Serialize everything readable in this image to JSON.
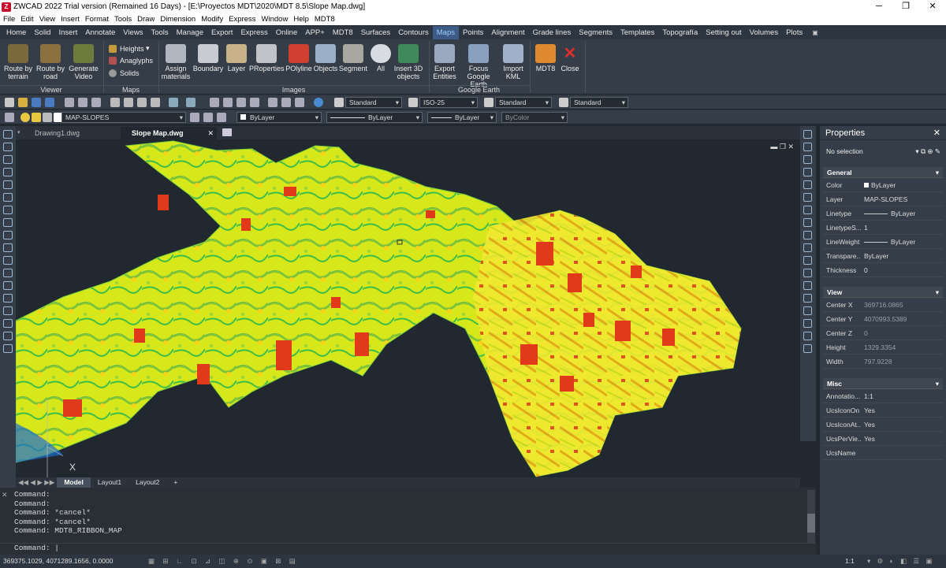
{
  "title": "ZWCAD 2022 Trial version (Remained 16 Days) - [E:\\Proyectos MDT\\2020\\MDT 8.5\\Slope Map.dwg]",
  "menu": [
    "File",
    "Edit",
    "View",
    "Insert",
    "Format",
    "Tools",
    "Draw",
    "Dimension",
    "Modify",
    "Express",
    "Window",
    "Help",
    "MDT8"
  ],
  "ribbon_tabs": [
    "Home",
    "Solid",
    "Insert",
    "Annotate",
    "Views",
    "Tools",
    "Manage",
    "Export",
    "Express",
    "Online",
    "APP+",
    "MDT8",
    "Surfaces",
    "Contours",
    "Maps",
    "Points",
    "Alignment",
    "Grade lines",
    "Segments",
    "Templates",
    "Topografía",
    "Setting out",
    "Volumes",
    "Plots"
  ],
  "ribbon": {
    "viewer": {
      "label": "Viewer",
      "buttons": [
        "Route by terrain",
        "Route by road",
        "Generate Video"
      ]
    },
    "maps": {
      "label": "Maps",
      "items": [
        "Heights",
        "Anaglyphs",
        "Solids"
      ]
    },
    "images": {
      "label": "Images",
      "buttons": [
        "Assign materials",
        "Boundary",
        "Layer",
        "PRoperties",
        "POlyline",
        "Objects",
        "Segment",
        "All",
        "Insert 3D objects"
      ]
    },
    "google_earth": {
      "label": "Google Earth",
      "buttons": [
        "Export Entities",
        "Focus Google Earth",
        "Import KML"
      ]
    },
    "mdt8": {
      "buttons": [
        "MDT8",
        "Close"
      ]
    }
  },
  "toolbar": {
    "text_style": "Standard",
    "dim_style": "ISO-25",
    "table_style": "Standard",
    "mleader_style": "Standard",
    "layer": "MAP-SLOPES",
    "color": "ByLayer",
    "linetype": "ByLayer",
    "lineweight": "ByLayer",
    "plotstyle": "ByColor"
  },
  "doc_tabs": [
    "Drawing1.dwg",
    "Slope Map.dwg"
  ],
  "layout_tabs": [
    "Model",
    "Layout1",
    "Layout2"
  ],
  "command_history": [
    "Command:",
    "Command:",
    "Command: *cancel*",
    "Command: *cancel*",
    "Command: MDT8_RIBBON_MAP"
  ],
  "command_prompt": "Command:",
  "status_coords": "369375.1029, 4071289.1656, 0.0000",
  "status_scale": "1:1",
  "properties": {
    "title": "Properties",
    "selection": "No selection",
    "general_label": "General",
    "general": [
      {
        "k": "Color",
        "v": "ByLayer"
      },
      {
        "k": "Layer",
        "v": "MAP-SLOPES"
      },
      {
        "k": "Linetype",
        "v": "ByLayer"
      },
      {
        "k": "LinetypeS...",
        "v": "1"
      },
      {
        "k": "LineWeight",
        "v": "ByLayer"
      },
      {
        "k": "Transpare...",
        "v": "ByLayer"
      },
      {
        "k": "Thickness",
        "v": "0"
      }
    ],
    "view_label": "View",
    "view": [
      {
        "k": "Center X",
        "v": "369716.0865"
      },
      {
        "k": "Center Y",
        "v": "4070993.5389"
      },
      {
        "k": "Center Z",
        "v": "0"
      },
      {
        "k": "Height",
        "v": "1329.3354"
      },
      {
        "k": "Width",
        "v": "797.9228"
      }
    ],
    "misc_label": "Misc",
    "misc": [
      {
        "k": "Annotatio...",
        "v": "1:1"
      },
      {
        "k": "UcsIconOn",
        "v": "Yes"
      },
      {
        "k": "UcsIconAt...",
        "v": "Yes"
      },
      {
        "k": "UcsPerVie...",
        "v": "Yes"
      },
      {
        "k": "UcsName",
        "v": ""
      }
    ]
  },
  "ucs_label": "X"
}
